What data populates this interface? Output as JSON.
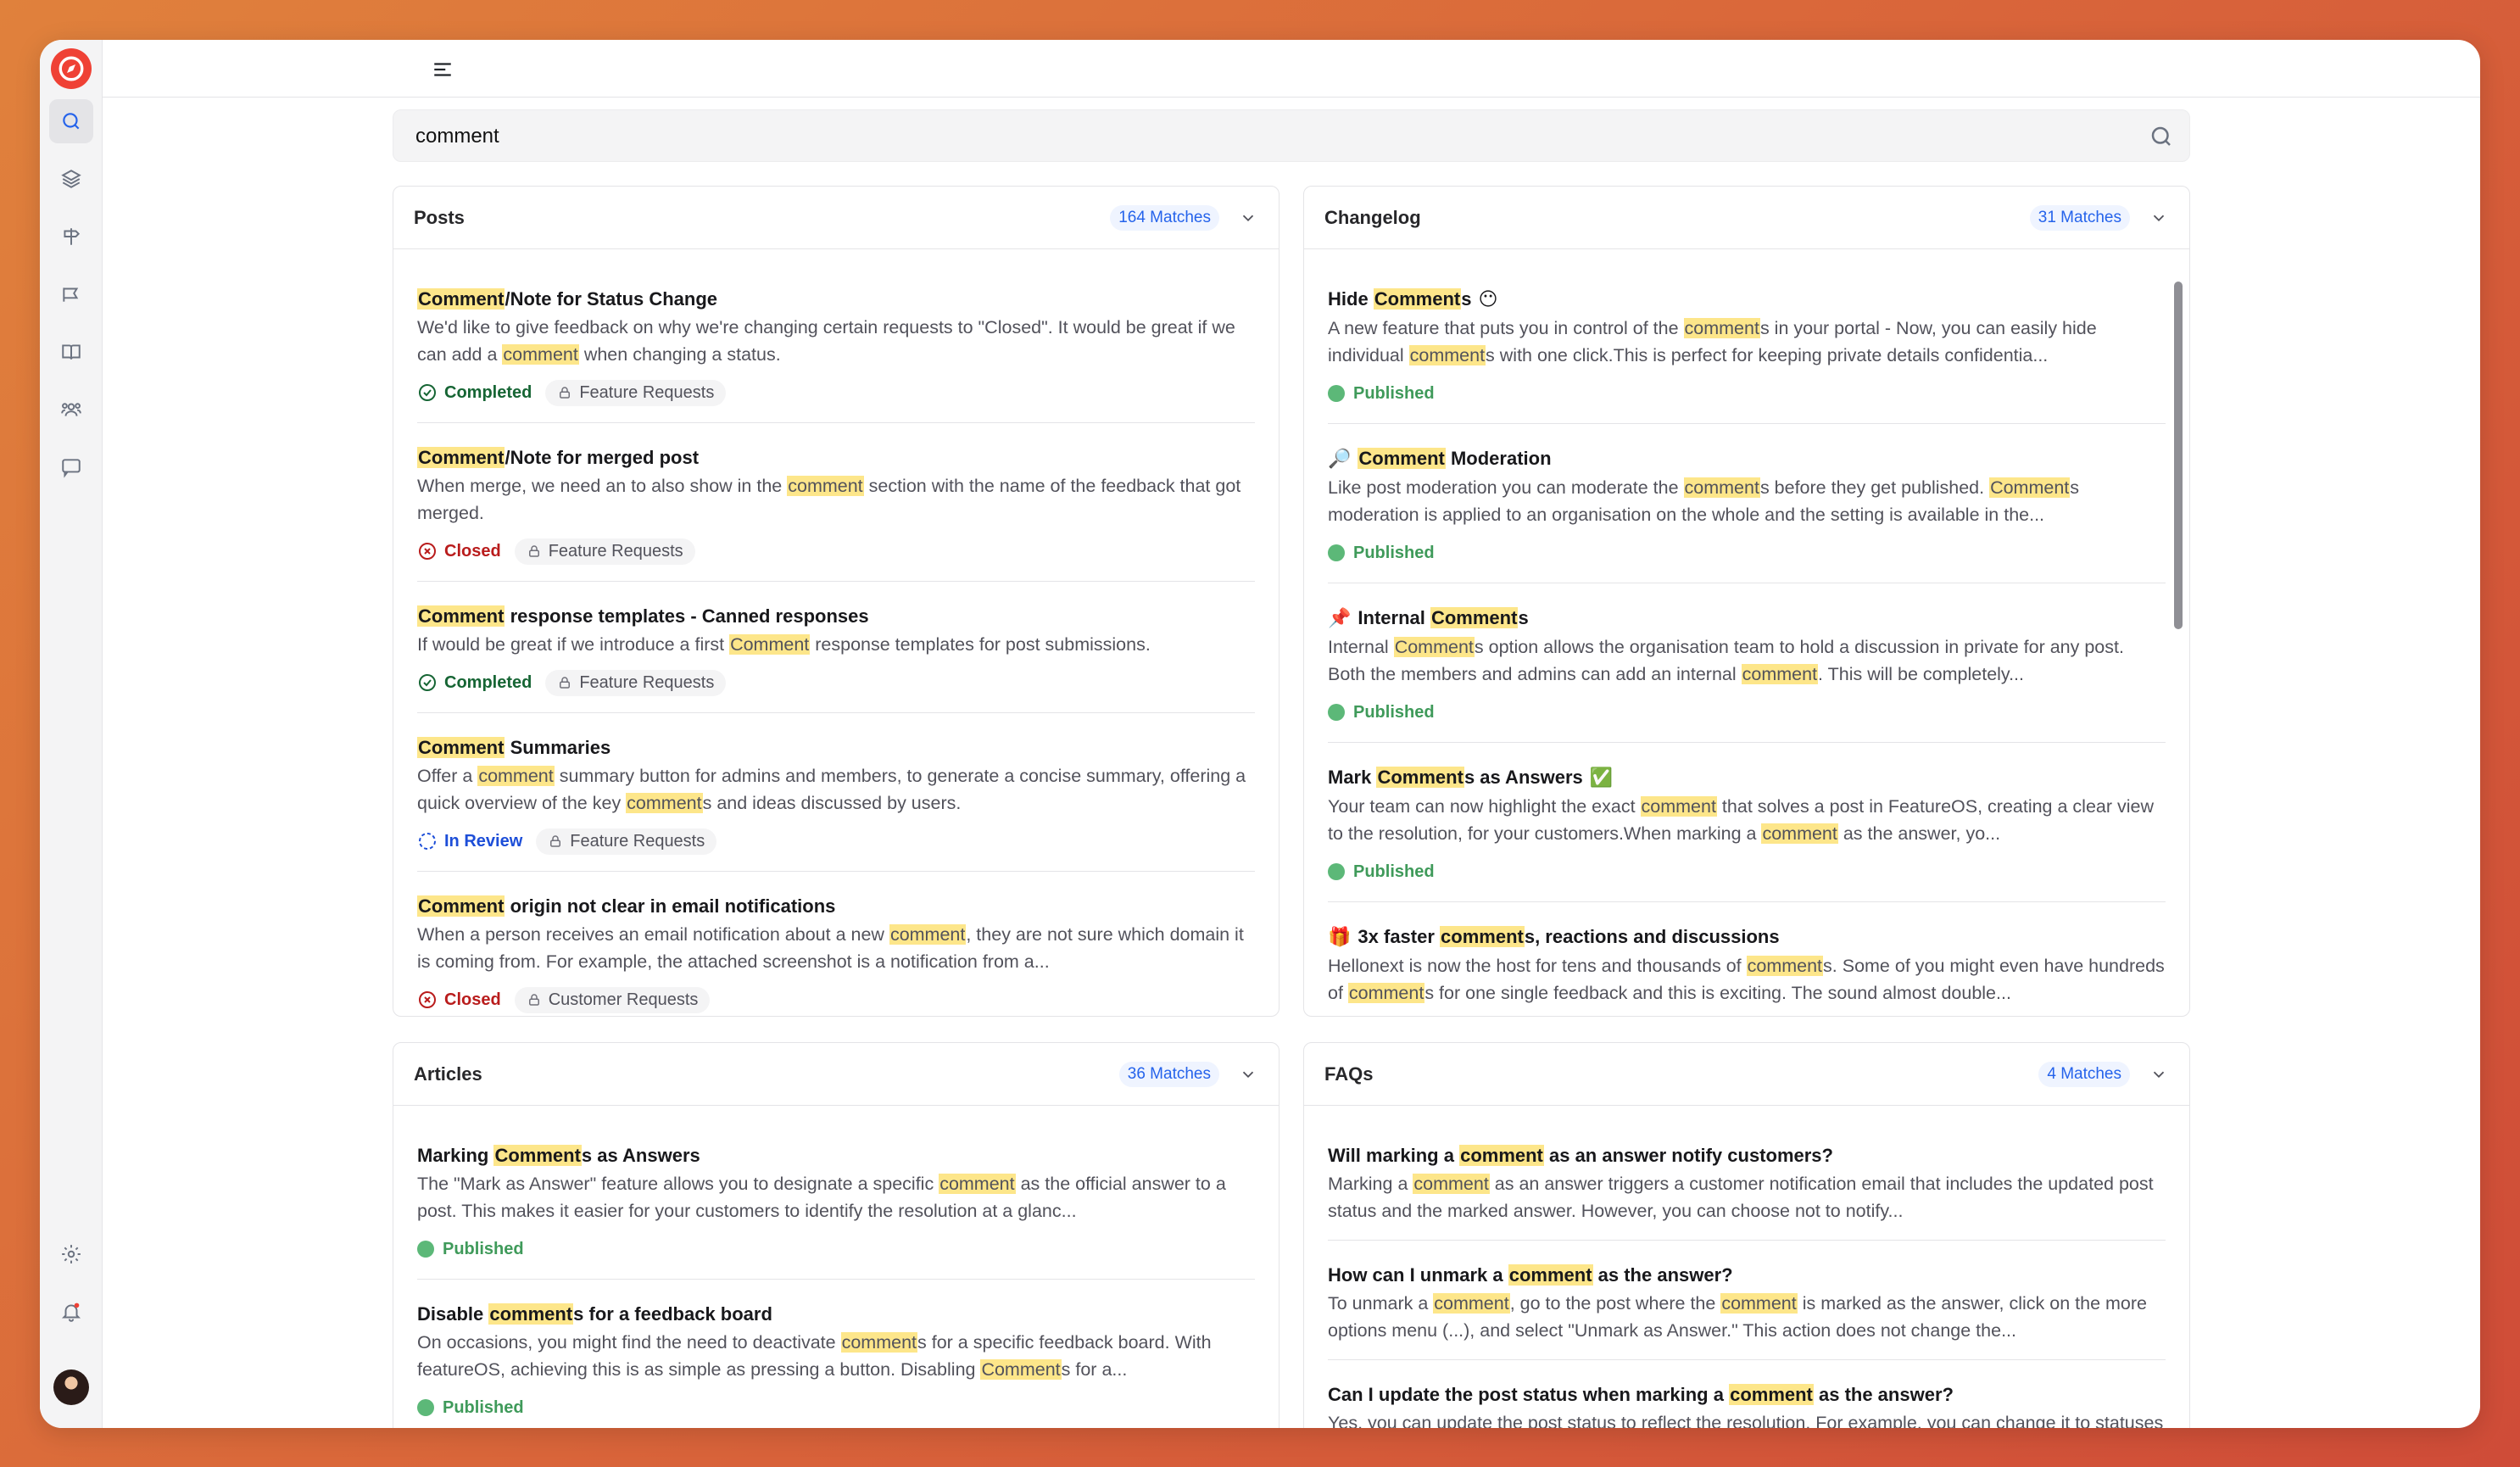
{
  "app": {
    "name": "FeatureOS"
  },
  "search": {
    "value": "comment",
    "placeholder": ""
  },
  "colors": {
    "accent": "#2563eb",
    "highlight": "#fde68a",
    "brand": "#ef4135",
    "published": "#5cb878"
  },
  "sidebar": {
    "items": [
      {
        "name": "search",
        "icon": "search-icon"
      },
      {
        "name": "layers",
        "icon": "layers-icon"
      },
      {
        "name": "roadmap",
        "icon": "signpost-icon"
      },
      {
        "name": "changelog",
        "icon": "megaphone-icon"
      },
      {
        "name": "knowledge-base",
        "icon": "book-icon"
      },
      {
        "name": "users",
        "icon": "users-icon"
      },
      {
        "name": "chat",
        "icon": "chat-icon"
      }
    ],
    "bottom": [
      {
        "name": "settings",
        "icon": "gear-icon"
      },
      {
        "name": "notifications",
        "icon": "bell-icon"
      }
    ]
  },
  "panels": {
    "posts": {
      "title": "Posts",
      "matches": "164 Matches",
      "items": [
        {
          "title": [
            [
              "h",
              "Comment"
            ],
            [
              "t",
              "/Note for Status Change"
            ]
          ],
          "desc": [
            [
              "t",
              "We'd like to give feedback on why we're changing certain requests to \"Closed\". It would be great if we can add a "
            ],
            [
              "h",
              "comment"
            ],
            [
              "t",
              " when changing a status."
            ]
          ],
          "status": "Completed",
          "status_type": "completed",
          "tag": "Feature Requests"
        },
        {
          "title": [
            [
              "h",
              "Comment"
            ],
            [
              "t",
              "/Note for merged post"
            ]
          ],
          "desc": [
            [
              "t",
              "When merge, we need an to also show in the "
            ],
            [
              "h",
              "comment"
            ],
            [
              "t",
              " section with the name of the feedback that got merged."
            ]
          ],
          "status": "Closed",
          "status_type": "closed",
          "tag": "Feature Requests"
        },
        {
          "title": [
            [
              "h",
              "Comment"
            ],
            [
              "t",
              " response templates - Canned responses"
            ]
          ],
          "desc": [
            [
              "t",
              "If would be great if we introduce a first "
            ],
            [
              "h",
              "Comment"
            ],
            [
              "t",
              " response templates for post submissions."
            ]
          ],
          "status": "Completed",
          "status_type": "completed",
          "tag": "Feature Requests"
        },
        {
          "title": [
            [
              "h",
              "Comment"
            ],
            [
              "t",
              " Summaries"
            ]
          ],
          "desc": [
            [
              "t",
              "Offer a "
            ],
            [
              "h",
              "comment"
            ],
            [
              "t",
              " summary button for admins and members, to generate a concise summary, offering a quick overview of the key "
            ],
            [
              "h",
              "comment"
            ],
            [
              "t",
              "s and ideas discussed by users."
            ]
          ],
          "status": "In Review",
          "status_type": "review",
          "tag": "Feature Requests"
        },
        {
          "title": [
            [
              "h",
              "Comment"
            ],
            [
              "t",
              " origin not clear in email notifications"
            ]
          ],
          "desc": [
            [
              "t",
              "When a person receives an email notification about a new "
            ],
            [
              "h",
              "comment"
            ],
            [
              "t",
              ", they are not sure which domain it is coming from. For example, the attached screenshot is a notification from a..."
            ]
          ],
          "status": "Closed",
          "status_type": "closed",
          "tag": "Customer Requests"
        }
      ]
    },
    "changelog": {
      "title": "Changelog",
      "matches": "31 Matches",
      "items": [
        {
          "emoji": "",
          "emoji_after": "😶",
          "title": [
            [
              "t",
              "Hide "
            ],
            [
              "h",
              "Comment"
            ],
            [
              "t",
              "s"
            ]
          ],
          "desc": [
            [
              "t",
              "A new feature that puts you in control of the "
            ],
            [
              "h",
              "comment"
            ],
            [
              "t",
              "s in your portal - Now, you can easily hide individual "
            ],
            [
              "h",
              "comment"
            ],
            [
              "t",
              "s with one click.This is perfect for keeping private details confidentia..."
            ]
          ],
          "status": "Published"
        },
        {
          "emoji": "🔎",
          "emoji_after": "",
          "title": [
            [
              "h",
              "Comment"
            ],
            [
              "t",
              " Moderation"
            ]
          ],
          "desc": [
            [
              "t",
              "Like post moderation you can moderate the "
            ],
            [
              "h",
              "comment"
            ],
            [
              "t",
              "s before they get published. "
            ],
            [
              "h",
              "Comment"
            ],
            [
              "t",
              "s moderation is applied to an organisation on the whole and the setting is available in the..."
            ]
          ],
          "status": "Published"
        },
        {
          "emoji": "📌",
          "emoji_after": "",
          "title": [
            [
              "t",
              "Internal "
            ],
            [
              "h",
              "Comment"
            ],
            [
              "t",
              "s"
            ]
          ],
          "desc": [
            [
              "t",
              "Internal "
            ],
            [
              "h",
              "Comment"
            ],
            [
              "t",
              "s option allows the organisation team to hold a discussion in private for any post. Both the members and admins can add an internal "
            ],
            [
              "h",
              "comment"
            ],
            [
              "t",
              ". This will be completely..."
            ]
          ],
          "status": "Published"
        },
        {
          "emoji": "",
          "emoji_after": "✅",
          "title": [
            [
              "t",
              "Mark "
            ],
            [
              "h",
              "Comment"
            ],
            [
              "t",
              "s as Answers"
            ]
          ],
          "desc": [
            [
              "t",
              "Your team can now highlight the exact "
            ],
            [
              "h",
              "comment"
            ],
            [
              "t",
              " that solves a post in FeatureOS, creating a clear view to the resolution, for your customers.When marking a "
            ],
            [
              "h",
              "comment"
            ],
            [
              "t",
              " as the answer, yo..."
            ]
          ],
          "status": "Published"
        },
        {
          "emoji": "🎁",
          "emoji_after": "",
          "title": [
            [
              "t",
              "3x faster "
            ],
            [
              "h",
              "comment"
            ],
            [
              "t",
              "s, reactions and discussions"
            ]
          ],
          "desc": [
            [
              "t",
              "Hellonext is now the host for tens and thousands of "
            ],
            [
              "h",
              "comment"
            ],
            [
              "t",
              "s. Some of you might even have hundreds of "
            ],
            [
              "h",
              "comment"
            ],
            [
              "t",
              "s for one single feedback and this is exciting. The sound almost double..."
            ]
          ],
          "status": "Published"
        }
      ]
    },
    "articles": {
      "title": "Articles",
      "matches": "36 Matches",
      "items": [
        {
          "title": [
            [
              "t",
              "Marking "
            ],
            [
              "h",
              "Comment"
            ],
            [
              "t",
              "s as Answers"
            ]
          ],
          "desc": [
            [
              "t",
              "The \"Mark as Answer\" feature allows you to designate a specific "
            ],
            [
              "h",
              "comment"
            ],
            [
              "t",
              " as the official answer to a post. This makes it easier for your customers to identify the resolution at a glanc..."
            ]
          ],
          "status": "Published"
        },
        {
          "title": [
            [
              "t",
              "Disable "
            ],
            [
              "h",
              "comment"
            ],
            [
              "t",
              "s for a feedback board"
            ]
          ],
          "desc": [
            [
              "t",
              "On occasions, you might find the need to deactivate "
            ],
            [
              "h",
              "comment"
            ],
            [
              "t",
              "s for a specific feedback board. With featureOS, achieving this is as simple as pressing a button. Disabling "
            ],
            [
              "h",
              "Comment"
            ],
            [
              "t",
              "s for a..."
            ]
          ],
          "status": "Published"
        }
      ]
    },
    "faqs": {
      "title": "FAQs",
      "matches": "4 Matches",
      "items": [
        {
          "title": [
            [
              "t",
              "Will marking a "
            ],
            [
              "h",
              "comment"
            ],
            [
              "t",
              " as an answer notify customers?"
            ]
          ],
          "desc": [
            [
              "t",
              "Marking a "
            ],
            [
              "h",
              "comment"
            ],
            [
              "t",
              " as an answer triggers a customer notification email that includes the updated post status and the marked answer. However, you can choose not to notify..."
            ]
          ]
        },
        {
          "title": [
            [
              "t",
              "How can I unmark a "
            ],
            [
              "h",
              "comment"
            ],
            [
              "t",
              " as the answer?"
            ]
          ],
          "desc": [
            [
              "t",
              "To unmark a "
            ],
            [
              "h",
              "comment"
            ],
            [
              "t",
              ", go to the post where the "
            ],
            [
              "h",
              "comment"
            ],
            [
              "t",
              " is marked as the answer, click on the more options menu (...), and select \"Unmark as Answer.\" This action does not change the..."
            ]
          ]
        },
        {
          "title": [
            [
              "t",
              "Can I update the post status when marking a "
            ],
            [
              "h",
              "comment"
            ],
            [
              "t",
              " as the answer?"
            ]
          ],
          "desc": [
            [
              "t",
              "Yes, you can update the post status to reflect the resolution. For example, you can change it to statuses like \"Completed\" or \"Resolved\" based on your workflow. This step is optional and..."
            ]
          ]
        }
      ]
    }
  }
}
